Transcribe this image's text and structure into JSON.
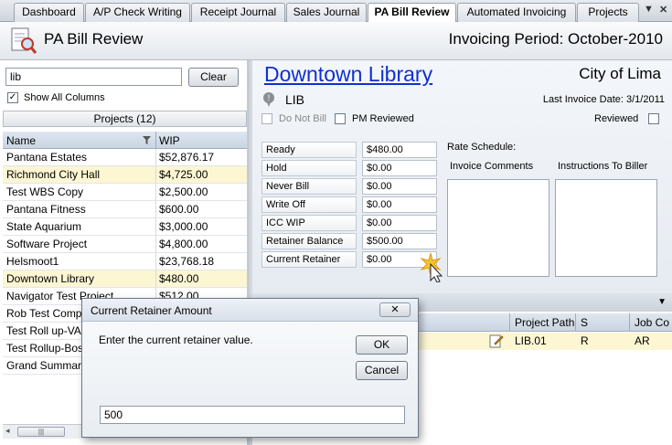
{
  "tabs": [
    {
      "label": "Dashboard"
    },
    {
      "label": "A/P Check Writing"
    },
    {
      "label": "Receipt Journal"
    },
    {
      "label": "Sales Journal"
    },
    {
      "label": "PA Bill Review",
      "active": true
    },
    {
      "label": "Automated Invoicing"
    },
    {
      "label": "Projects"
    }
  ],
  "tab_controls": {
    "dropdown": "▼",
    "close": "✕"
  },
  "header": {
    "title": "PA Bill Review",
    "period": "Invoicing Period: October-2010",
    "icon": "magnifier-document-icon"
  },
  "search": {
    "value": "lib",
    "clear_label": "Clear"
  },
  "show_all_columns": {
    "label": "Show All Columns",
    "checked": true
  },
  "projects_header": "Projects (12)",
  "columns": {
    "name": "Name",
    "wip": "WIP"
  },
  "projects": [
    {
      "name": "Pantana Estates",
      "wip": "$52,876.17",
      "highlight": false
    },
    {
      "name": "Richmond City Hall",
      "wip": "$4,725.00",
      "highlight": true
    },
    {
      "name": "Test WBS Copy",
      "wip": "$2,500.00",
      "highlight": false
    },
    {
      "name": "Pantana Fitness",
      "wip": "$600.00",
      "highlight": false
    },
    {
      "name": "State Aquarium",
      "wip": "$3,000.00",
      "highlight": false
    },
    {
      "name": "Software Project",
      "wip": "$4,800.00",
      "highlight": false
    },
    {
      "name": "Helsmoot1",
      "wip": "$23,768.18",
      "highlight": false
    },
    {
      "name": "Downtown Library",
      "wip": "$480.00",
      "highlight": true
    },
    {
      "name": "Navigator Test Project",
      "wip": "$512.00",
      "highlight": false
    },
    {
      "name": "Rob Test Company",
      "wip": "",
      "highlight": false
    },
    {
      "name": "Test Roll up-VA",
      "wip": "",
      "highlight": false
    },
    {
      "name": "Test Rollup-Boston",
      "wip": "",
      "highlight": false
    },
    {
      "name": "Grand Summaries",
      "wip": "",
      "highlight": false
    }
  ],
  "detail": {
    "project_title": "Downtown Library",
    "client": "City of Lima",
    "code": "LIB",
    "last_invoice": "Last Invoice Date: 3/1/2011",
    "do_not_bill": "Do Not Bill",
    "pm_reviewed": "PM Reviewed",
    "reviewed": "Reviewed",
    "rate_schedule": "Rate Schedule:",
    "invoice_comments": "Invoice Comments",
    "instructions": "Instructions To Biller",
    "fields": [
      {
        "label": "Ready",
        "value": "$480.00"
      },
      {
        "label": "Hold",
        "value": "$0.00"
      },
      {
        "label": "Never Bill",
        "value": "$0.00"
      },
      {
        "label": "Write Off",
        "value": "$0.00"
      },
      {
        "label": "ICC WIP",
        "value": "$0.00"
      },
      {
        "label": "Retainer Balance",
        "value": "$500.00"
      },
      {
        "label": "Current Retainer",
        "value": "$0.00"
      }
    ]
  },
  "grid": {
    "headers": [
      "Project Path",
      "S",
      "Job Co"
    ],
    "row": {
      "path": "LIB.01",
      "s": "R",
      "job": "AR"
    }
  },
  "dialog": {
    "title": "Current Retainer Amount",
    "prompt": "Enter the current retainer value.",
    "ok": "OK",
    "cancel": "Cancel",
    "value": "500",
    "close": "✕"
  }
}
